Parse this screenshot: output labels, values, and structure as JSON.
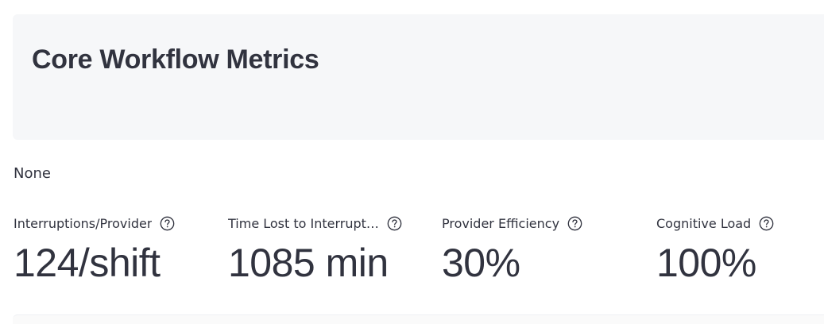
{
  "header": {
    "title": "Core Workflow Metrics"
  },
  "status_text": "None",
  "metrics": [
    {
      "label": "Interruptions/Provider",
      "value": "124/shift",
      "icon": "help-circle-icon"
    },
    {
      "label": "Time Lost to Interrupt…",
      "value": "1085 min",
      "icon": "help-circle-icon"
    },
    {
      "label": "Provider Efficiency",
      "value": "30%",
      "icon": "help-circle-icon"
    },
    {
      "label": "Cognitive Load",
      "value": "100%",
      "icon": "help-circle-icon"
    }
  ],
  "colors": {
    "text": "#31333f",
    "header_background": "#f6f7f9",
    "icon": "#31333f"
  }
}
